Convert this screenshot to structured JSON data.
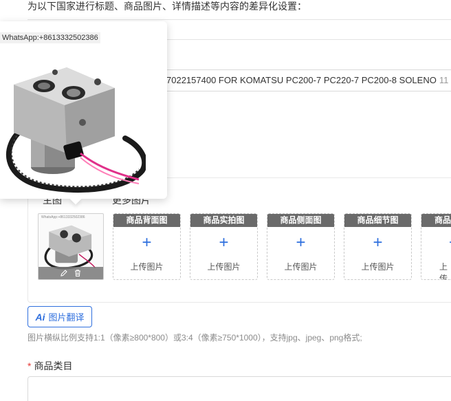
{
  "header_note": "为以下国家进行标题、商品图片、详情描述等内容的差异化设置：",
  "title_field": {
    "value": "7022157400 FOR KOMATSU PC200-7 PC220-7 PC200-8 SOLENO",
    "count": "11"
  },
  "image_tabs": {
    "main": "主图",
    "more": "更多图片"
  },
  "preview": {
    "watermark": "WhatsApp:+8613332502386"
  },
  "thumb_watermark": "WhatsApp:+8613332502386",
  "slots": [
    {
      "header": "商品背面图",
      "upload_label": "上传图片"
    },
    {
      "header": "商品实拍图",
      "upload_label": "上传图片"
    },
    {
      "header": "商品侧面图",
      "upload_label": "上传图片"
    },
    {
      "header": "商品细节图",
      "upload_label": "上传图片"
    },
    {
      "header": "商品",
      "upload_label": "上传"
    }
  ],
  "ai_translate": {
    "icon_text": "Ai",
    "label": "图片翻译"
  },
  "image_hint": "图片横纵比例支持1:1（像素≥800*800）或3:4（像素≥750*1000），支持jpg、jpeg、png格式;",
  "category": {
    "required_mark": "*",
    "label": "商品类目"
  },
  "colors": {
    "accent": "#2f6fde",
    "slot_header": "#6a6a6a",
    "required": "#e53935"
  }
}
